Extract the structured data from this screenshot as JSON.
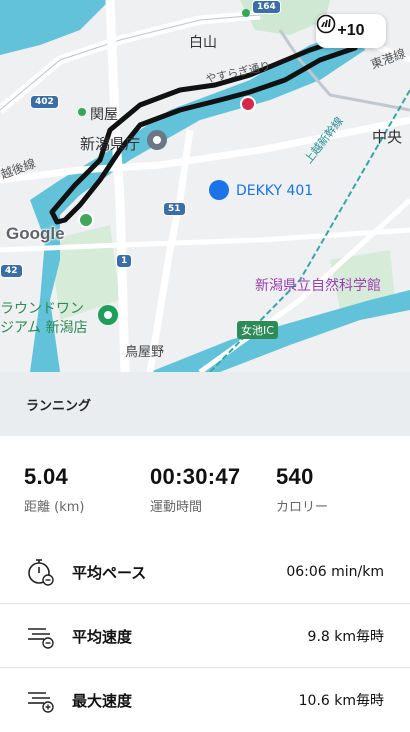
{
  "map": {
    "badge_text": "+10",
    "google_logo": "Google",
    "labels": {
      "hakusan": "白山",
      "sekiya": "関屋",
      "yasuragi_dori": "やすらぎ通り",
      "higashi_kosen": "東港線",
      "niigata_kencho": "新潟県庁",
      "chuo": "中央",
      "joetsu_shinkansen": "上越新幹線",
      "dekky": "DEKKY 401",
      "koshisen": "越後線",
      "shizen_kagakukan": "新潟県立自然科学館",
      "round_one_1": "ラウンドワン",
      "round_one_2": "ジアム 新潟店",
      "toriyano": "鳥屋野",
      "megaike_ic": "女池IC"
    },
    "shields": {
      "r402": "402",
      "r51": "51",
      "r1": "1",
      "r42": "42",
      "r164": "164"
    }
  },
  "activity": {
    "type_label": "ランニング"
  },
  "stats": [
    {
      "value": "5.04",
      "label": "距離 (km)"
    },
    {
      "value": "00:30:47",
      "label": "運動時間"
    },
    {
      "value": "540",
      "label": "カロリー"
    }
  ],
  "metrics": [
    {
      "label": "平均ペース",
      "value": "06:06 min/km",
      "icon": "stopwatch-icon"
    },
    {
      "label": "平均速度",
      "value": "9.8 km毎時",
      "icon": "speed-lines-icon"
    },
    {
      "label": "最大速度",
      "value": "10.6 km毎時",
      "icon": "speed-lines-plus-icon"
    }
  ],
  "colors": {
    "river": "#62c2da",
    "route": "#111111",
    "start": "#3fa65a",
    "end": "#d8284a",
    "section_bg": "#e9edf0"
  }
}
